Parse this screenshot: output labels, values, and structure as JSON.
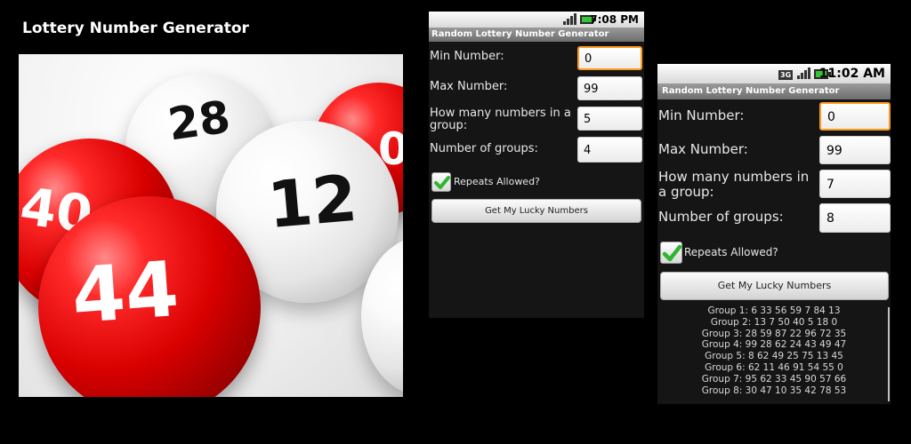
{
  "promo": {
    "title": "Lottery Number Generator",
    "ball_numbers": [
      "28",
      "12",
      "40",
      "44",
      "0"
    ]
  },
  "phone_small": {
    "status_time": "7:08 PM",
    "app_title": "Random Lottery Number Generator",
    "min_label": "Min Number:",
    "min_value": "0",
    "max_label": "Max Number:",
    "max_value": "99",
    "count_label": "How many numbers in a group:",
    "count_value": "5",
    "groups_label": "Number of groups:",
    "groups_value": "4",
    "repeats_label": "Repeats Allowed?",
    "repeats_checked": true,
    "button_label": "Get My Lucky Numbers"
  },
  "phone_large": {
    "status_time": "11:02 AM",
    "network_badge": "3G",
    "app_title": "Random Lottery Number Generator",
    "min_label": "Min Number:",
    "min_value": "0",
    "max_label": "Max Number:",
    "max_value": "99",
    "count_label": "How many numbers in a group:",
    "count_value": "7",
    "groups_label": "Number of groups:",
    "groups_value": "8",
    "repeats_label": "Repeats Allowed?",
    "repeats_checked": true,
    "button_label": "Get My Lucky Numbers",
    "results": [
      "Group 1: 6 33 56 59 7 84 13",
      "Group 2: 13 7 50 40 5 18 0",
      "Group 3: 28 59 87 22 96 72 35",
      "Group 4: 99 28 62 24 43 49 47",
      "Group 5: 8 62 49 25 75 13 45",
      "Group 6: 62 11 46 91 54 55 0",
      "Group 7: 95 62 33 45 90 57 66",
      "Group 8: 30 47 10 35 42 78 53"
    ]
  },
  "colors": {
    "background": "#000000",
    "focus_border": "#ff9a1e",
    "check_green": "#2fb52f",
    "ball_red": "#d90000"
  }
}
